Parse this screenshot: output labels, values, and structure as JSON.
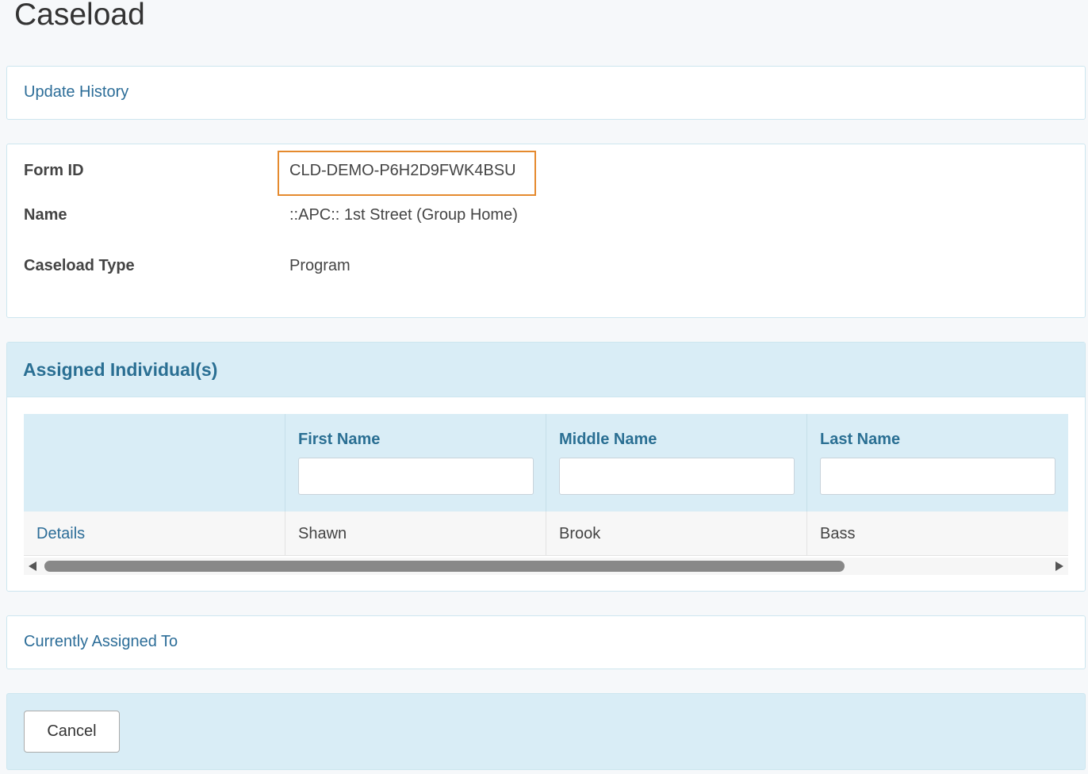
{
  "page": {
    "title": "Caseload"
  },
  "update_history": {
    "label": "Update History"
  },
  "info": {
    "form_id_label": "Form ID",
    "form_id_value": "CLD-DEMO-P6H2D9FWK4BSU",
    "name_label": "Name",
    "name_value": "::APC:: 1st Street (Group Home)",
    "type_label": "Caseload Type",
    "type_value": "Program"
  },
  "assigned": {
    "title": "Assigned Individual(s)",
    "columns": [
      {
        "label": "First Name",
        "filter_value": ""
      },
      {
        "label": "Middle Name",
        "filter_value": ""
      },
      {
        "label": "Last Name",
        "filter_value": ""
      }
    ],
    "rows": [
      {
        "action": "Details",
        "first": "Shawn",
        "middle": "Brook",
        "last": "Bass"
      }
    ]
  },
  "currently_assigned": {
    "label": "Currently Assigned To"
  },
  "footer": {
    "cancel_label": "Cancel"
  },
  "colors": {
    "highlight": "#e58a2e",
    "link": "#2c6d98",
    "header_bg": "#d9edf6"
  }
}
